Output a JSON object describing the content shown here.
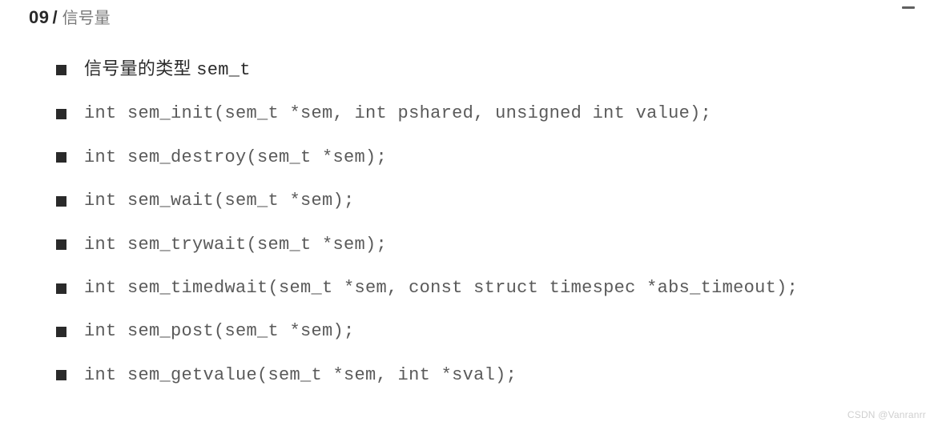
{
  "header": {
    "page_num": "09",
    "slash": "/",
    "title": "信号量"
  },
  "items": [
    {
      "label_cn": "信号量的类型 ",
      "label_code": "sem_t"
    },
    {
      "text": "int sem_init(sem_t *sem, int pshared, unsigned int value);"
    },
    {
      "text": "int sem_destroy(sem_t *sem);"
    },
    {
      "text": "int sem_wait(sem_t *sem);"
    },
    {
      "text": "int sem_trywait(sem_t *sem);"
    },
    {
      "text": "int sem_timedwait(sem_t *sem, const struct timespec *abs_timeout);"
    },
    {
      "text": "int sem_post(sem_t *sem);"
    },
    {
      "text": "int sem_getvalue(sem_t *sem, int *sval);"
    }
  ],
  "watermark": "CSDN @Vanranrr"
}
